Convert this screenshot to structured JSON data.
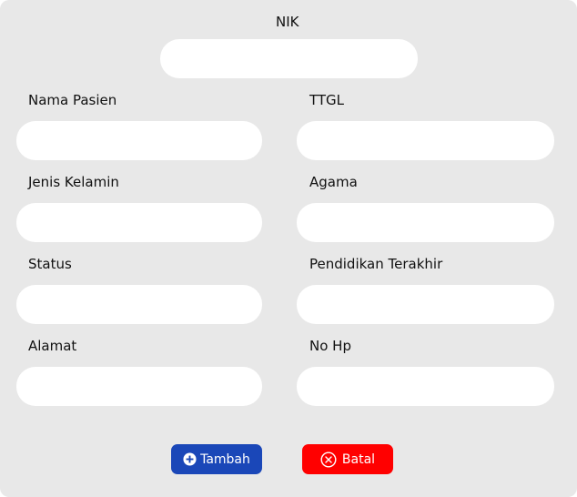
{
  "form": {
    "nik": {
      "label": "NIK",
      "value": ""
    },
    "nama_pasien": {
      "label": "Nama Pasien",
      "value": ""
    },
    "ttgl": {
      "label": "TTGL",
      "value": ""
    },
    "jenis_kelamin": {
      "label": "Jenis Kelamin",
      "value": ""
    },
    "agama": {
      "label": "Agama",
      "value": ""
    },
    "status": {
      "label": "Status",
      "value": ""
    },
    "pendidikan": {
      "label": "Pendidikan Terakhir",
      "value": ""
    },
    "alamat": {
      "label": "Alamat",
      "value": ""
    },
    "no_hp": {
      "label": "No Hp",
      "value": ""
    }
  },
  "actions": {
    "tambah": {
      "label": "Tambah",
      "icon": "plus-circle-icon",
      "color": "#1a47b8"
    },
    "batal": {
      "label": "Batal",
      "icon": "x-circle-icon",
      "color": "#ff0000"
    }
  },
  "colors": {
    "panel": "#e8e8e8",
    "field": "#ffffff"
  }
}
